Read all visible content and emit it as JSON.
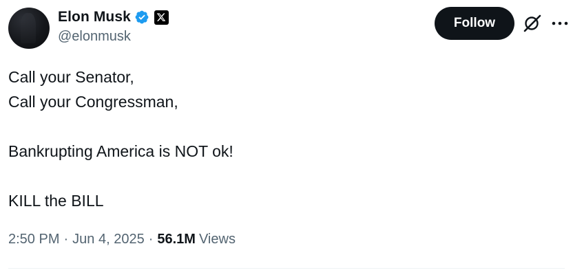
{
  "author": {
    "display_name": "Elon Musk",
    "handle": "@elonmusk",
    "verified_color": "#1d9bf0"
  },
  "header": {
    "follow_label": "Follow"
  },
  "icons": {
    "verified": "verified-badge-icon",
    "affiliation": "x-logo-icon",
    "grok": "grok-icon",
    "more": "more-icon"
  },
  "tweet": {
    "lines": [
      "Call your Senator,",
      "Call your Congressman,",
      "",
      "Bankrupting America is NOT ok!",
      "",
      "KILL the BILL"
    ]
  },
  "meta": {
    "time": "2:50 PM",
    "separator": "·",
    "date": "Jun 4, 2025",
    "views_count": "56.1M",
    "views_label": "Views"
  }
}
